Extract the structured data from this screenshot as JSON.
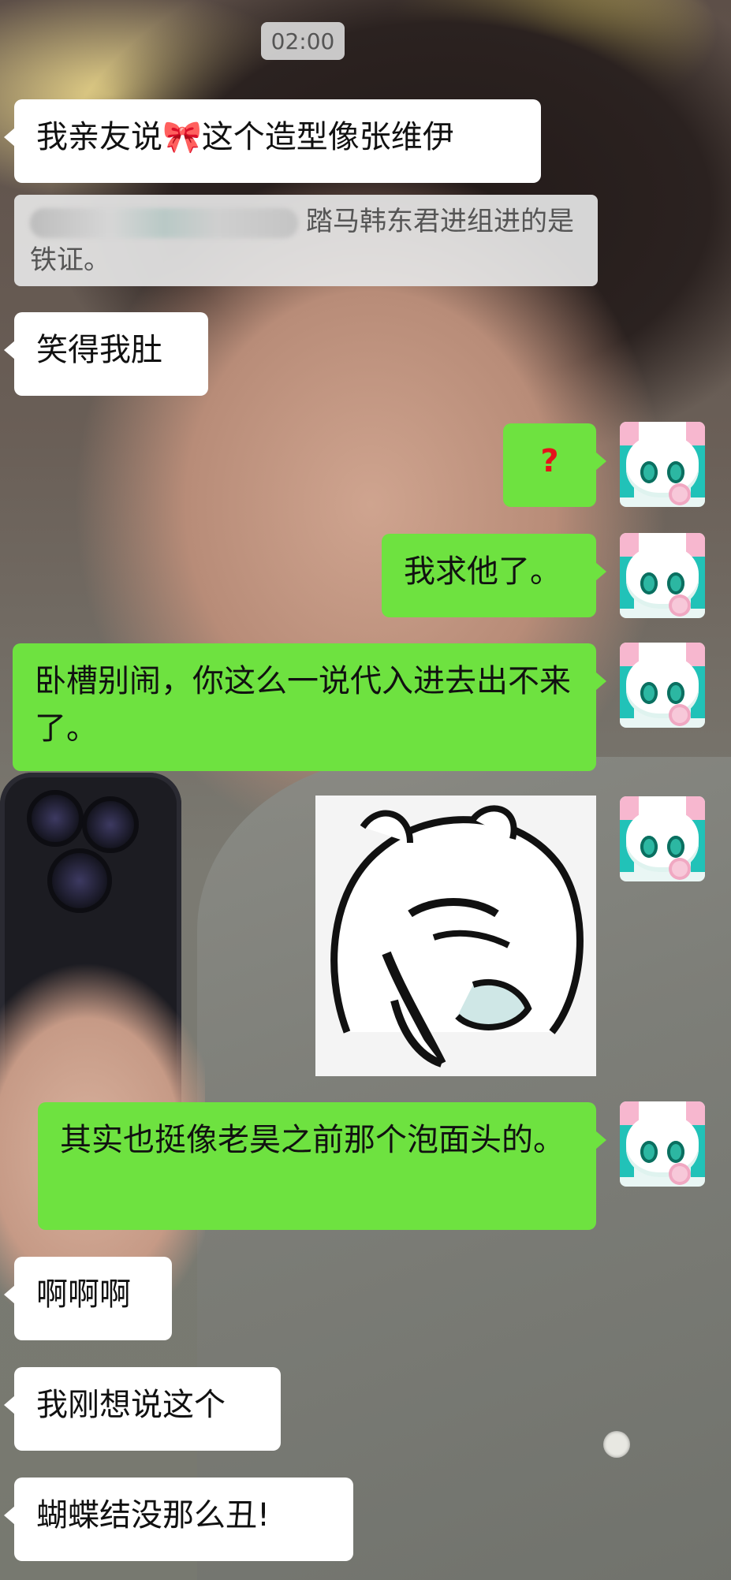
{
  "time": "02:00",
  "messages": [
    {
      "side": "in",
      "text": "我亲友说🎀这个造型像张维伊"
    },
    {
      "side": "in",
      "type": "quote",
      "text": "踏马韩东君进组进的是铁证。"
    },
    {
      "side": "in",
      "text": "笑得我肚"
    },
    {
      "side": "out",
      "text": "?"
    },
    {
      "side": "out",
      "text": "我求他了。"
    },
    {
      "side": "out",
      "text": "卧槽别闹，你这么一说代入进去出不来了。"
    },
    {
      "side": "out",
      "type": "sticker",
      "icon": "rabbit-sticker"
    },
    {
      "side": "out",
      "text": "其实也挺像老昊之前那个泡面头的。"
    },
    {
      "side": "in",
      "text": "啊啊啊"
    },
    {
      "side": "in",
      "text": "我刚想说这个"
    },
    {
      "side": "in",
      "text": "蝴蝶结没那么丑!"
    }
  ],
  "colors": {
    "outgoing_bubble": "#6ee240",
    "incoming_bubble": "#ffffff",
    "question_mark": "#e5131c"
  },
  "avatar_icon": "rabbit-avatar-icon"
}
